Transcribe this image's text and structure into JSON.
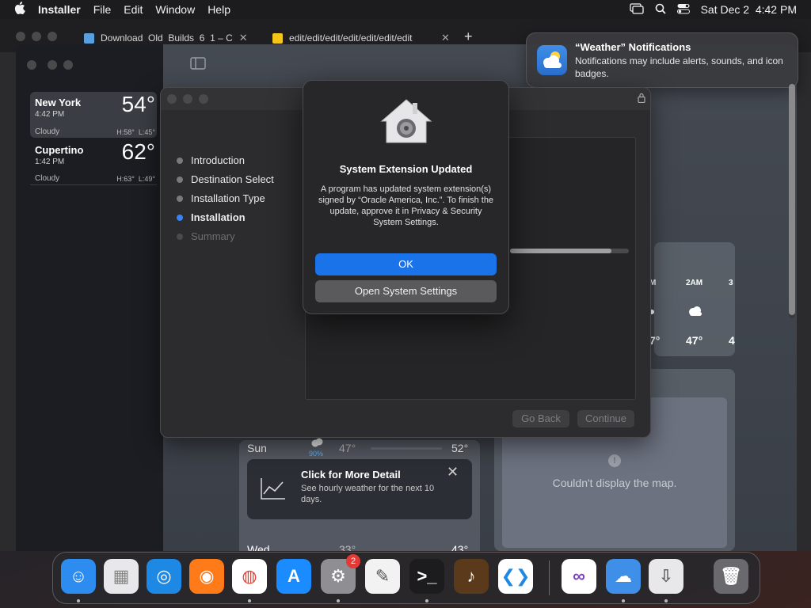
{
  "menubar": {
    "app_name": "Installer",
    "menus": [
      "File",
      "Edit",
      "Window",
      "Help"
    ],
    "clock": "Sat Dec 2  4:42 PM"
  },
  "browser": {
    "tabs": [
      {
        "label": "Download  Old  Builds  6  1 – C"
      },
      {
        "label": "edit/edit/edit/edit/edit/edit/edit"
      }
    ],
    "new_tab": "+"
  },
  "notification": {
    "title": "“Weather” Notifications",
    "message": "Notifications may include alerts, sounds, and icon badges."
  },
  "weather": {
    "cities": [
      {
        "name": "New York",
        "time": "4:42 PM",
        "temp": "54°",
        "condition": "Cloudy",
        "hilo": "H:58°  L:45°"
      },
      {
        "name": "Cupertino",
        "time": "1:42 PM",
        "temp": "62°",
        "condition": "Cloudy",
        "hilo": "H:63°  L:49°"
      }
    ],
    "hourly": {
      "hour_partial_left": "M",
      "hour": "2AM",
      "hour_partial_right": "3",
      "temp_partial_left": "7°",
      "temp": "47°",
      "temp_partial_right": "4"
    },
    "map_message": "Couldn't display the map.",
    "daily": [
      {
        "day": "Sun",
        "precip": "90%",
        "low": "47°",
        "high": "52°"
      },
      {
        "day": "Wed",
        "low": "33°",
        "high": "43°"
      }
    ],
    "tip": {
      "title": "Click for More Detail",
      "message": "See hourly weather for the next 10 days."
    }
  },
  "installer": {
    "steps": [
      {
        "label": "Introduction",
        "state": "done"
      },
      {
        "label": "Destination Select",
        "state": "done"
      },
      {
        "label": "Installation Type",
        "state": "done"
      },
      {
        "label": "Installation",
        "state": "active"
      },
      {
        "label": "Summary",
        "state": "pending"
      }
    ],
    "progress": 0.85,
    "go_back_label": "Go Back",
    "continue_label": "Continue"
  },
  "alert": {
    "title": "System Extension Updated",
    "message": "A program has updated system extension(s) signed by “Oracle America, Inc.”. To finish the update, approve it in Privacy & Security System Settings.",
    "ok_label": "OK",
    "open_settings_label": "Open System Settings"
  },
  "dock": {
    "items": [
      {
        "name": "Finder",
        "icon": "finder-icon",
        "color": "#2d8cf0",
        "running": true
      },
      {
        "name": "Launchpad",
        "icon": "launchpad-icon",
        "color": "#e8e8ea",
        "running": false
      },
      {
        "name": "Safari",
        "icon": "safari-icon",
        "color": "#1e88e5",
        "running": false
      },
      {
        "name": "Firefox",
        "icon": "firefox-icon",
        "color": "#ff7a18",
        "running": false
      },
      {
        "name": "Chrome",
        "icon": "chrome-icon",
        "color": "#ffffff",
        "running": true
      },
      {
        "name": "App Store",
        "icon": "appstore-icon",
        "color": "#1a8cff",
        "running": false
      },
      {
        "name": "System Settings",
        "icon": "settings-icon",
        "color": "#8e8e93",
        "running": true,
        "badge": "2"
      },
      {
        "name": "TextEdit",
        "icon": "textedit-icon",
        "color": "#f2f2f2",
        "running": false
      },
      {
        "name": "Terminal",
        "icon": "terminal-icon",
        "color": "#1c1c1e",
        "running": true
      },
      {
        "name": "GarageBand",
        "icon": "garageband-icon",
        "color": "#5a3a1a",
        "running": false
      },
      {
        "name": "Visual Studio Code",
        "icon": "vscode-icon",
        "color": "#ffffff",
        "running": false
      },
      {
        "name": "Visual Studio",
        "icon": "visualstudio-icon",
        "color": "#ffffff",
        "running": false
      },
      {
        "name": "Weather",
        "icon": "weather-icon",
        "color": "#3f8ee8",
        "running": true
      },
      {
        "name": "Installer",
        "icon": "installer-icon",
        "color": "#e8e8ea",
        "running": true
      },
      {
        "name": "Trash",
        "icon": "trash-icon",
        "color": "#6a6a6e",
        "running": false
      }
    ]
  }
}
